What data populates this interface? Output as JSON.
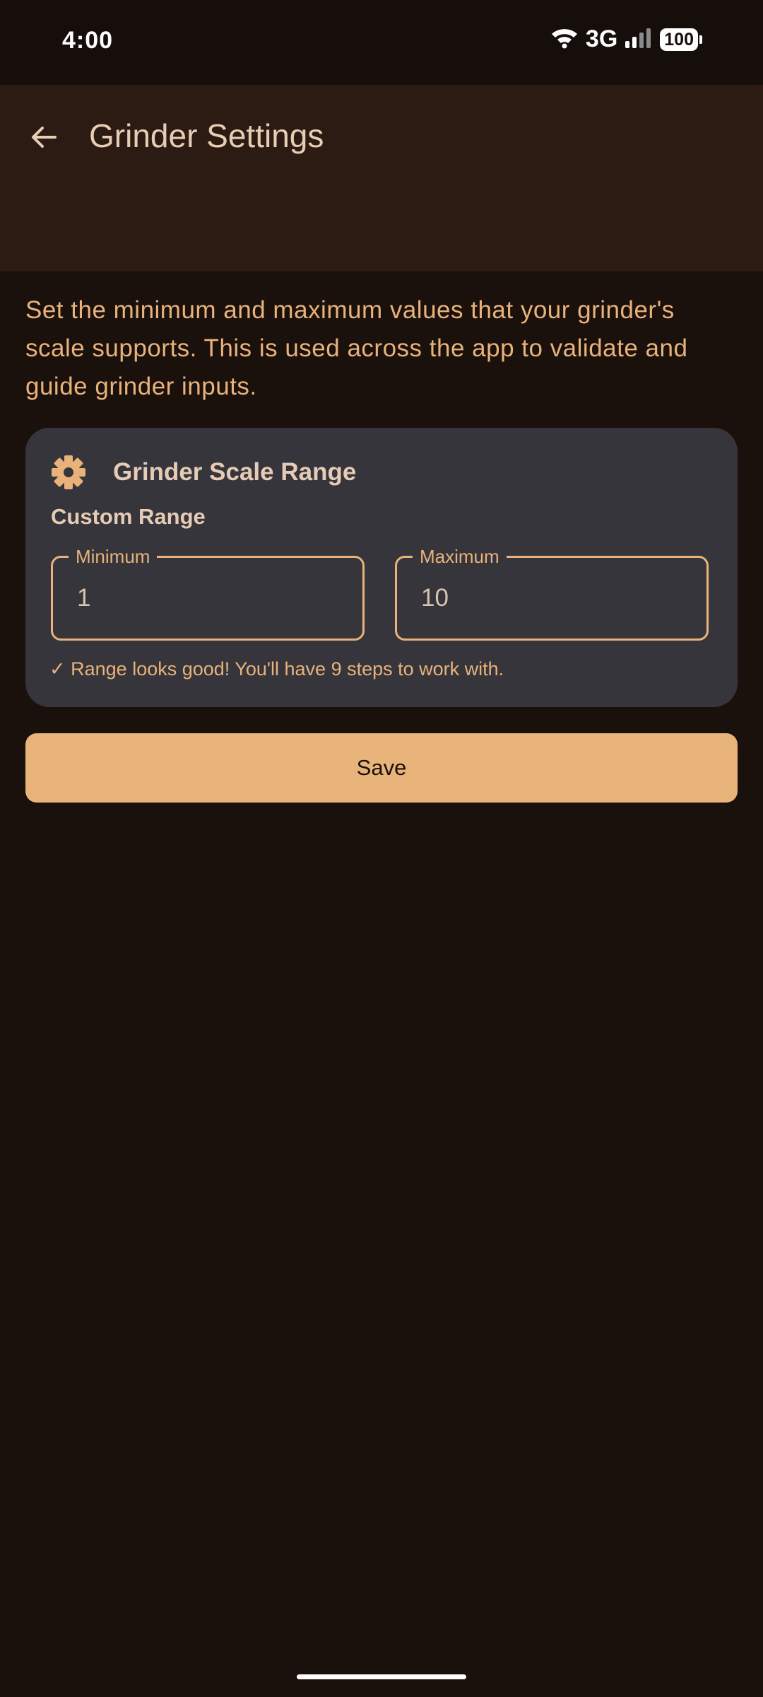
{
  "status_bar": {
    "time": "4:00",
    "network": "3G",
    "battery": "100"
  },
  "app_bar": {
    "title": "Grinder Settings"
  },
  "description": "Set the minimum and maximum values that your grinder's scale supports. This is used across the app to validate and guide grinder inputs.",
  "card": {
    "icon": "gear-icon",
    "title": "Grinder Scale Range",
    "range_label": "Custom Range",
    "minimum": {
      "label": "Minimum",
      "value": "1"
    },
    "maximum": {
      "label": "Maximum",
      "value": "10"
    },
    "message": "✓ Range looks good! You'll have 9 steps to work with."
  },
  "save_label": "Save",
  "colors": {
    "background": "#1a100c",
    "app_bar": "#2c1b12",
    "accent": "#e8b27a",
    "card": "#36353b",
    "title_text": "#e8cdb5"
  }
}
